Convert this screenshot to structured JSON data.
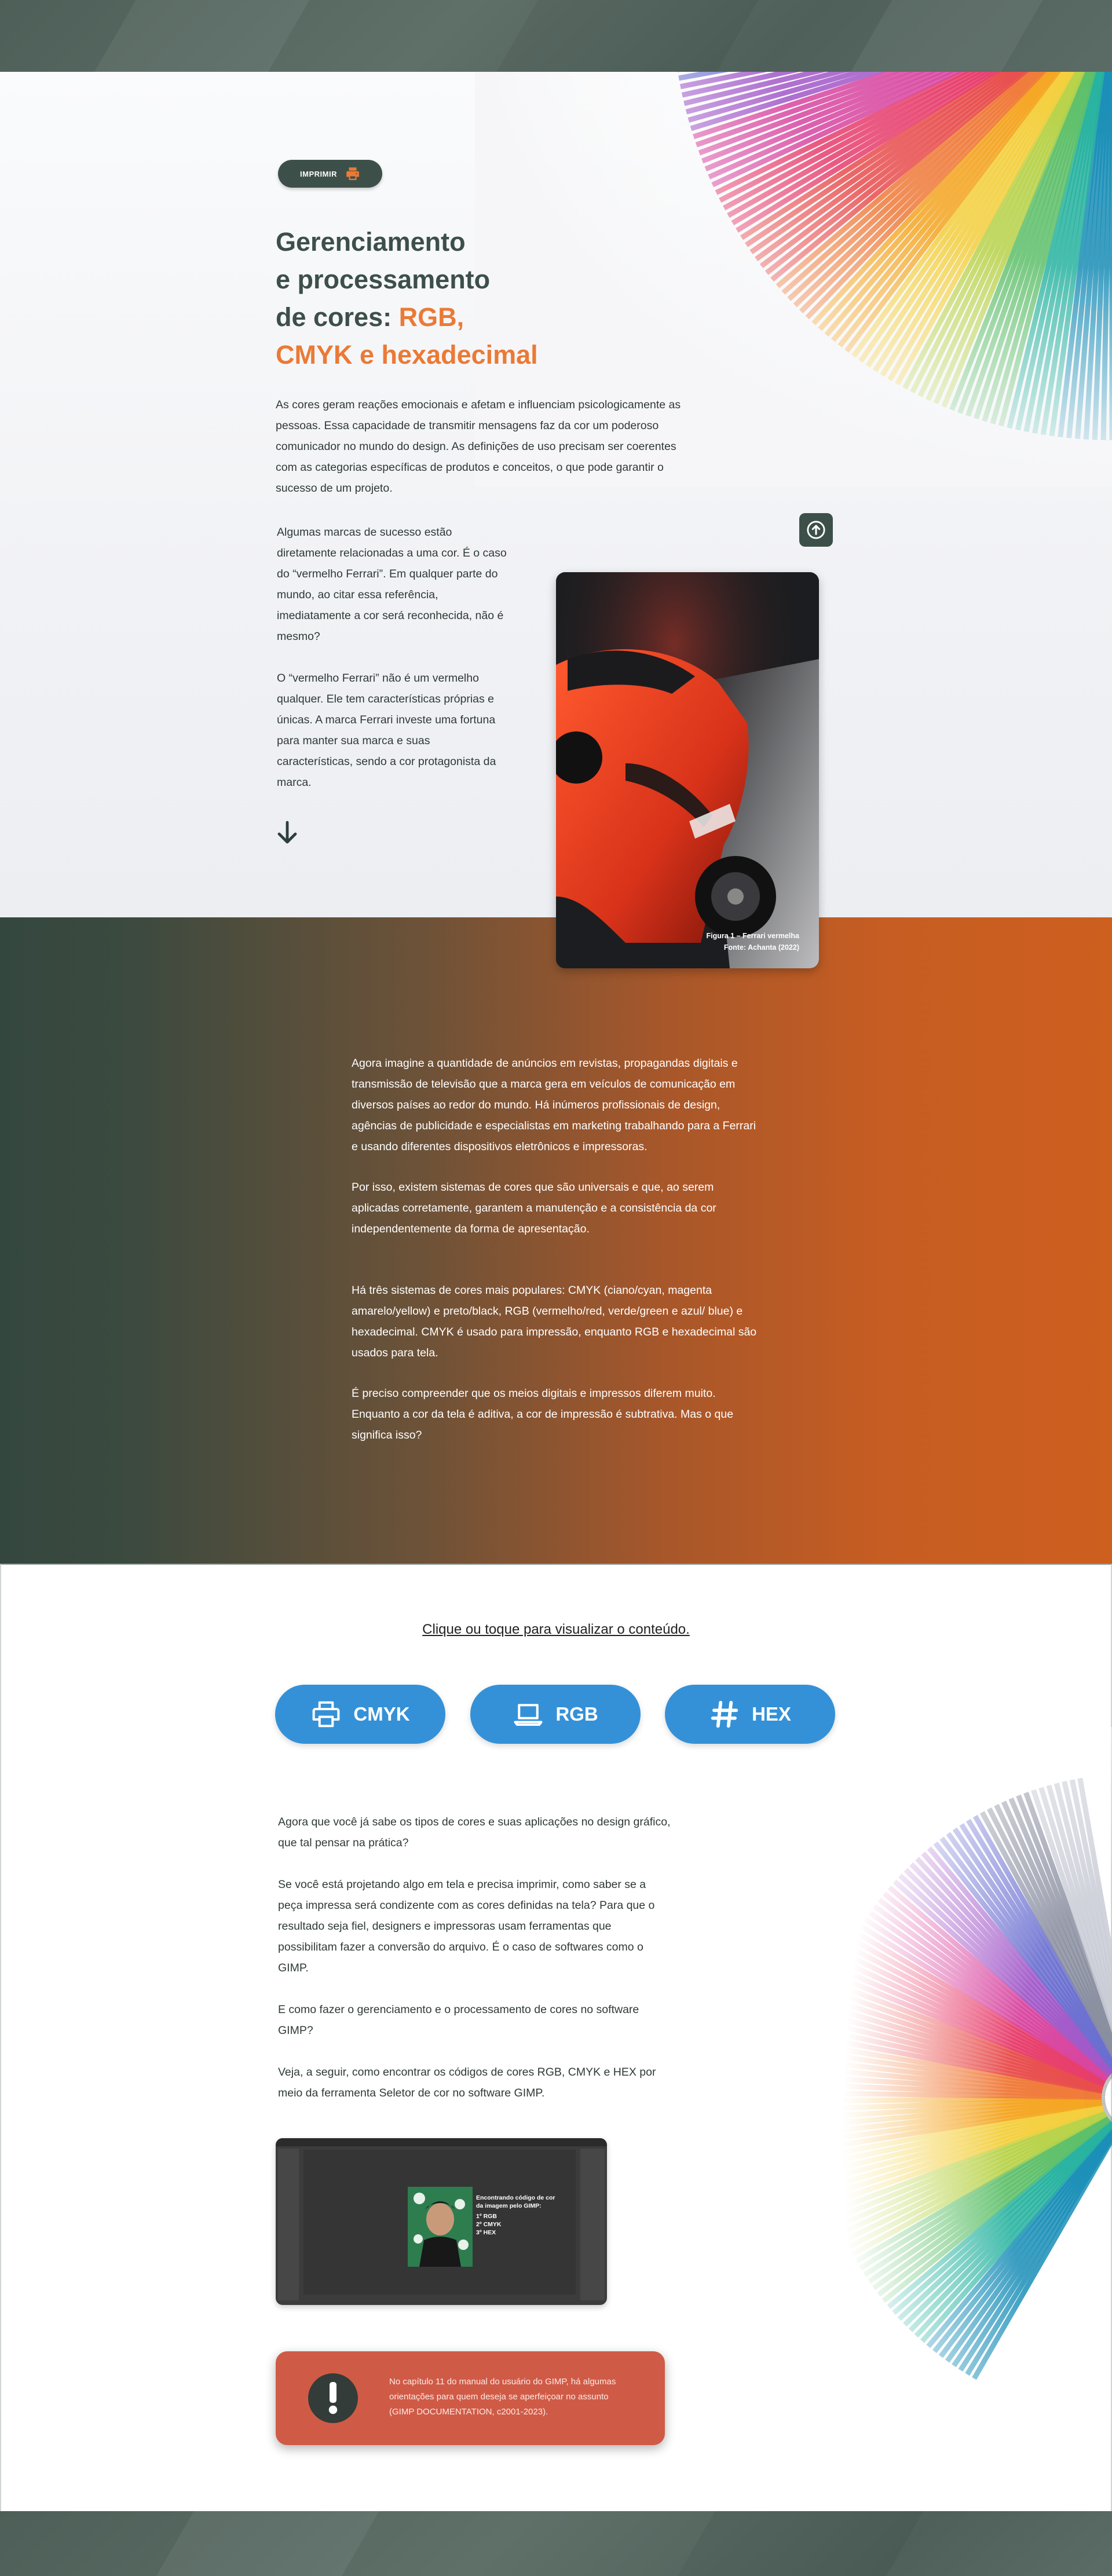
{
  "toolbar": {
    "print_label": "IMPRIMIR"
  },
  "title": {
    "line1": "Gerenciamento",
    "line2": "e processamento",
    "line3_prefix": "de cores: ",
    "highlight_line1": "RGB,",
    "highlight_line2": "CMYK e hexadecimal"
  },
  "intro": "As cores geram reações emocionais e afetam e influenciam psicologicamente as pessoas. Essa capacidade de transmitir mensagens faz da cor um poderoso comunicador no mundo do design. As definições de uso precisam ser coerentes com as categorias específicas de produtos e conceitos, o que pode garantir o sucesso de um projeto.",
  "side_p1": "Algumas marcas de sucesso estão diretamente relacionadas a uma cor. É o caso do “vermelho Ferrari”. Em qualquer parte do mundo, ao citar essa referência, imediatamente a cor será reconhecida, não é mesmo?",
  "side_p2": "O “vermelho Ferrari” não é um vermelho qualquer. Ele tem características próprias e únicas. A marca Ferrari investe uma fortuna para manter sua marca e suas características, sendo a cor protagonista da marca.",
  "figure": {
    "caption1": "Figura 1 – Ferrari vermelha",
    "caption2": "Fonte: Achanta (2022)"
  },
  "orange": {
    "p1": "Agora imagine a quantidade de anúncios em revistas, propagandas digitais e transmissão de televisão que a marca gera em veículos de comunicação em diversos países ao redor do mundo. Há inúmeros profissionais de design, agências de publicidade e especialistas em marketing trabalhando para a Ferrari e usando diferentes dispositivos eletrônicos e impressoras.",
    "p2": "Por isso, existem sistemas de cores que são universais e que, ao serem aplicadas corretamente, garantem a manutenção e a consistência da cor independentemente da forma de apresentação.",
    "p3": "Há três sistemas de cores mais populares: CMYK (ciano/cyan, magenta amarelo/yellow) e preto/black, RGB (vermelho/red, verde/green e azul/ blue) e hexadecimal. CMYK é usado para impressão, enquanto RGB e hexadecimal são usados para tela.",
    "p4": "É preciso compreender que os meios digitais e impressos diferem muito. Enquanto a cor da tela é aditiva, a cor de impressão é subtrativa. Mas o que significa isso?"
  },
  "content_link": "Clique ou toque para visualizar o conteúdo.",
  "buttons": {
    "cmyk": "CMYK",
    "rgb": "RGB",
    "hex": "HEX"
  },
  "body": {
    "p1": "Agora que você já sabe os tipos de cores e suas aplicações no design gráfico, que tal pensar na prática?",
    "p2": "Se você está projetando algo em tela e precisa imprimir, como saber se a peça impressa será condizente com as cores definidas na tela? Para que o resultado seja fiel, designers e impressoras usam ferramentas que possibilitam fazer a conversão do arquivo. É o caso de softwares como o GIMP.",
    "p3": " E como fazer o gerenciamento e o processamento de cores no software GIMP?",
    "p4": "Veja, a seguir, como encontrar os códigos de cores RGB, CMYK e HEX por meio da ferramenta Seletor de cor no software GIMP."
  },
  "video": {
    "heading": "Encontrando código de cor da imagem pelo GIMP:",
    "item1": "1º RGB",
    "item2": "2º CMYK",
    "item3": "3º HEX"
  },
  "alert": {
    "text": "No capítulo 11 do manual do usuário do GIMP, há algumas orientações para quem deseja se aperfeiçoar no assunto (GIMP DOCUMENTATION, c2001-2023)."
  },
  "colors": {
    "accent": "#ea7a36",
    "dark": "#3d4f49",
    "blue": "#3491d8",
    "alert": "#cf5b47"
  }
}
